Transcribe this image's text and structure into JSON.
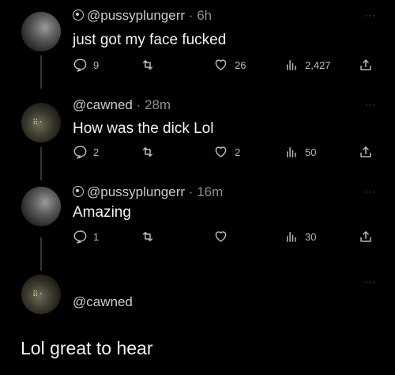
{
  "posts": [
    {
      "handle": "@pussyplungerr",
      "time": "6h",
      "text": "just got my face fucked",
      "replies": "9",
      "retweets": "",
      "likes": "26",
      "views": "2,427"
    },
    {
      "handle": "@cawned",
      "time": "28m",
      "text": "How was the dick Lol",
      "replies": "2",
      "retweets": "",
      "likes": "2",
      "views": "50"
    },
    {
      "handle": "@pussyplungerr",
      "time": "16m",
      "text": "Amazing",
      "replies": "1",
      "retweets": "",
      "likes": "",
      "views": "30"
    },
    {
      "handle": "@cawned"
    }
  ],
  "separator": "·",
  "more_label": "···",
  "reply_text": "Lol great to hear",
  "colors": {
    "background": "#000000",
    "text": "#e7e9ea",
    "muted": "#8b8f93"
  }
}
